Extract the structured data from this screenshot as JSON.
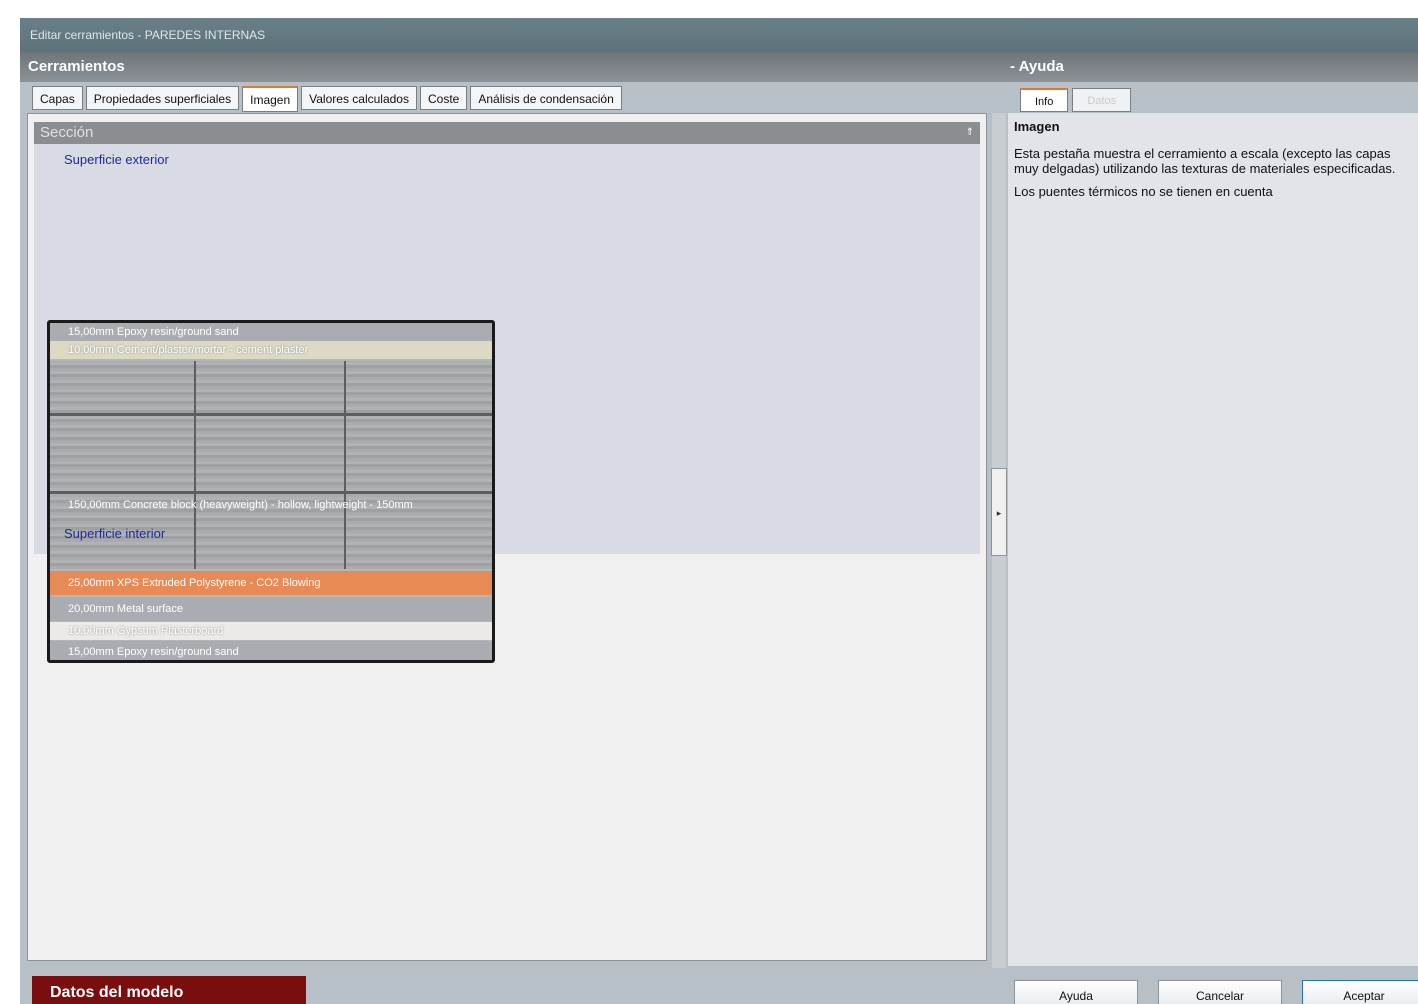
{
  "window": {
    "title": "Editar cerramientos - PAREDES INTERNAS"
  },
  "panel": {
    "title": "Cerramientos"
  },
  "tabs": [
    {
      "label": "Capas",
      "active": false
    },
    {
      "label": "Propiedades superficiales",
      "active": false
    },
    {
      "label": "Imagen",
      "active": true
    },
    {
      "label": "Valores calculados",
      "active": false
    },
    {
      "label": "Coste",
      "active": false
    },
    {
      "label": "Análisis de condensación",
      "active": false
    }
  ],
  "section": {
    "title": "Sección",
    "outer_surface": "Superficie exterior",
    "inner_surface": "Superficie interior",
    "layers": [
      {
        "label": "15,00mm Epoxy resin/ground sand",
        "color": "#a9adb1"
      },
      {
        "label": "10,00mm Cement/plaster/mortar - cement plaster",
        "color": "#dcd9c4"
      },
      {
        "label": "150,00mm Concrete block (heavyweight) - hollow, lightweight - 150mm",
        "color": "#a3a6a9"
      },
      {
        "label": "25,00mm XPS Extruded Polystyrene - CO2 Blowing",
        "color": "#e88a55"
      },
      {
        "label": "20,00mm Metal surface",
        "color": "#a9adb1"
      },
      {
        "label": "10,00mm Gypsum Plasterboard",
        "color": "#eceae6"
      },
      {
        "label": "15,00mm Epoxy resin/ground sand",
        "color": "#a9adb1"
      }
    ]
  },
  "help": {
    "title": "Ayuda",
    "tabs": [
      {
        "label": "Info",
        "active": true
      },
      {
        "label": "Datos",
        "active": false
      }
    ],
    "heading": "Imagen",
    "paragraphs": [
      "Esta pestaña muestra el cerramiento a escala (excepto las capas muy delgadas) utilizando las texturas de materiales especificadas.",
      "Los puentes térmicos no se tienen en cuenta"
    ]
  },
  "footer": {
    "model_tab": "Datos del modelo",
    "help_button": "Ayuda",
    "cancel_button": "Cancelar",
    "ok_button": "Aceptar"
  }
}
